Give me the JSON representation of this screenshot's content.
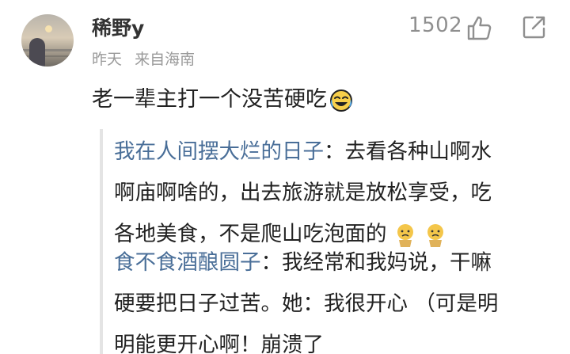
{
  "comment": {
    "username": "稀野y",
    "time": "昨天",
    "location": "来自海南",
    "like_count": "1502",
    "text": "老一辈主打一个没苦硬吃"
  },
  "replies": [
    {
      "author": "我在人间摆大烂的日子",
      "separator": "：",
      "lines": [
        "去看各种山啊水",
        "啊庙啊啥的，出去旅游就是放松享受，吃",
        "各地美食，不是爬山吃泡面的"
      ]
    },
    {
      "author": "食不食酒酿圆子",
      "separator": "：",
      "lines": [
        "我经常和我妈说，干嘛",
        "硬要把日子过苦。她：我很开心  （可是明",
        "明能更开心啊！崩溃了"
      ]
    }
  ],
  "icons": {
    "like": "thumbs-up-icon",
    "share": "share-icon",
    "comment_emoji": "laugh-cry-emoji",
    "reply_emoji": "sad-face-emoji"
  },
  "colors": {
    "author_link": "#496e98",
    "meta_text": "#9a9a9a",
    "quote_bar": "#e4e4e4"
  }
}
